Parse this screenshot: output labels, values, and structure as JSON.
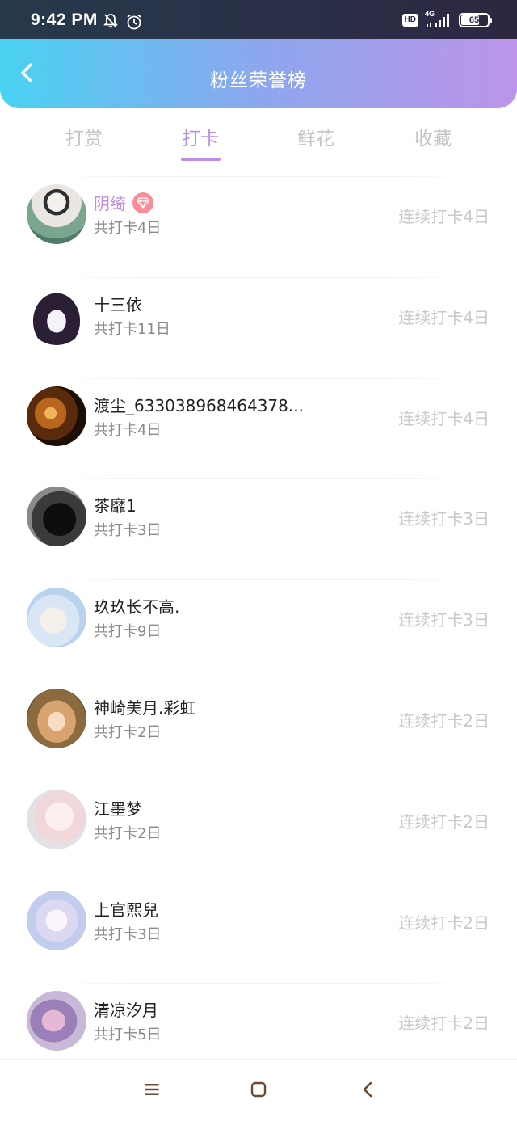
{
  "status_bar": {
    "time": "9:42 PM",
    "icons": [
      "mute-bell-icon",
      "alarm-icon",
      "hd-icon",
      "4g-signal-icon",
      "battery-icon"
    ],
    "hd": "HD",
    "network": "4G",
    "battery": "65",
    "battery_level": 0.65
  },
  "header": {
    "title": "粉丝荣誉榜",
    "back_icon": "chevron-left-icon"
  },
  "tabs": [
    {
      "label": "打赏",
      "active": false
    },
    {
      "label": "打卡",
      "active": true
    },
    {
      "label": "鲜花",
      "active": false
    },
    {
      "label": "收藏",
      "active": false
    }
  ],
  "colors": {
    "accent": "#c08de6",
    "header_gradient_start": "#49d2f2",
    "header_gradient_end": "#bd94ea",
    "vip_badge": "#f98c96",
    "muted_text": "#c8c8c8"
  },
  "fans": [
    {
      "name": "阴绮",
      "total": "共打卡4日",
      "streak": "连续打卡4日",
      "vip": true
    },
    {
      "name": "十三依",
      "total": "共打卡11日",
      "streak": "连续打卡4日",
      "vip": false
    },
    {
      "name": "渡尘_633038968464378...",
      "total": "共打卡4日",
      "streak": "连续打卡4日",
      "vip": false
    },
    {
      "name": "茶靡1",
      "total": "共打卡3日",
      "streak": "连续打卡3日",
      "vip": false
    },
    {
      "name": "玖玖长不高.",
      "total": "共打卡9日",
      "streak": "连续打卡3日",
      "vip": false
    },
    {
      "name": "神崎美月.彩虹",
      "total": "共打卡2日",
      "streak": "连续打卡2日",
      "vip": false
    },
    {
      "name": "江墨梦",
      "total": "共打卡2日",
      "streak": "连续打卡2日",
      "vip": false
    },
    {
      "name": "上官熙兒",
      "total": "共打卡3日",
      "streak": "连续打卡2日",
      "vip": false
    },
    {
      "name": "清凉汐月",
      "total": "共打卡5日",
      "streak": "连续打卡2日",
      "vip": false
    }
  ],
  "nav_bar": {
    "icons": [
      "menu-icon",
      "home-square-icon",
      "back-triangle-icon"
    ]
  }
}
